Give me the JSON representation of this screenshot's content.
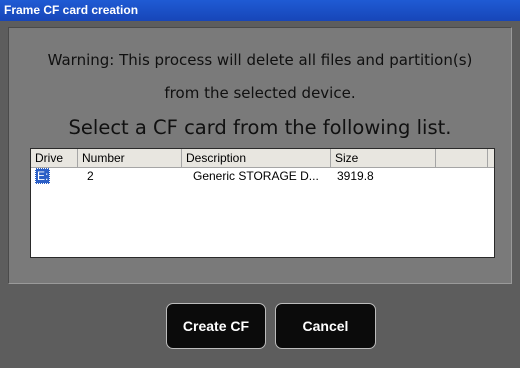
{
  "window": {
    "title": "Frame CF card creation"
  },
  "warning": {
    "line1": "Warning: This process will delete all files and partition(s)",
    "line2": "from the selected device."
  },
  "prompt": "Select a CF card from the following list.",
  "list": {
    "columns": [
      "Drive",
      "Number",
      "Description",
      "Size",
      ""
    ],
    "rows": [
      {
        "drive": "E:",
        "number": "2",
        "description": "Generic STORAGE D...",
        "size": "3919.8"
      }
    ],
    "selected_row": 0
  },
  "buttons": {
    "create": "Create CF",
    "cancel": "Cancel"
  }
}
